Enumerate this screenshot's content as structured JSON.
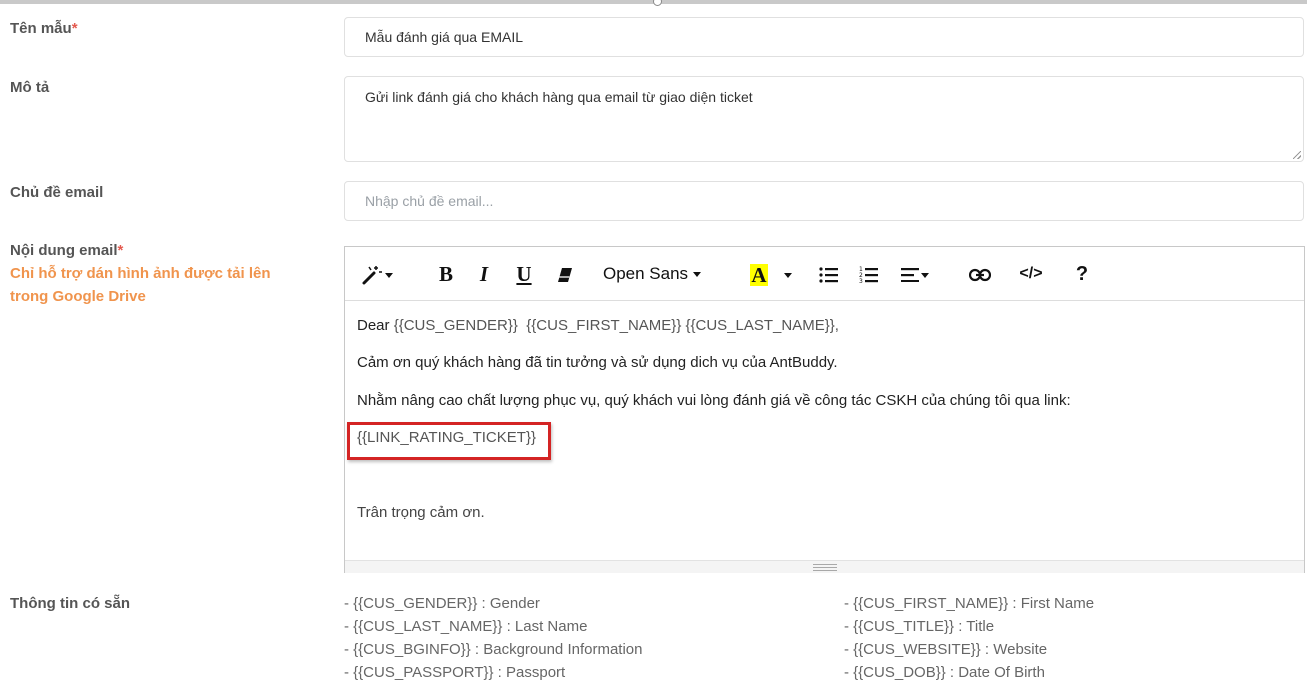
{
  "form": {
    "template_name": {
      "label": "Tên mẫu",
      "required_mark": "*",
      "value": "Mẫu đánh giá qua EMAIL"
    },
    "description": {
      "label": "Mô tả",
      "value": "Gửi link đánh giá cho khách hàng qua email từ giao diện ticket"
    },
    "email_subject": {
      "label": "Chủ đề email",
      "value": "",
      "placeholder": "Nhập chủ đề email..."
    },
    "email_content": {
      "label": "Nội dung email",
      "required_mark": "*",
      "note": "Chỉ hỗ trợ dán hình ảnh được tải lên trong Google Drive"
    },
    "available_info": {
      "label": "Thông tin có sẵn"
    }
  },
  "editor": {
    "toolbar": {
      "font_name": "Open Sans",
      "bold_glyph": "B",
      "italic_glyph": "I",
      "underline_glyph": "U",
      "color_glyph": "A",
      "code_glyph": "</>",
      "help_glyph": "?",
      "color_highlight": "#ffff00",
      "icons": [
        "magic-wand-icon",
        "bold-icon",
        "italic-icon",
        "underline-icon",
        "eraser-icon",
        "text-color-icon",
        "bulleted-list-icon",
        "numbered-list-icon",
        "align-icon",
        "link-icon",
        "code-view-icon",
        "help-icon"
      ]
    },
    "content": {
      "line1_prefix": "Dear ",
      "line1_gender": "{{CUS_GENDER}}",
      "line1_first": "{{CUS_FIRST_NAME}}",
      "line1_last": "{{CUS_LAST_NAME}},",
      "line2": "Cảm ơn quý khách hàng đã tin tưởng và sử dụng dich vụ của AntBuddy.",
      "line3": "Nhằm nâng cao chất lượng phục vụ, quý khách vui lòng đánh giá về công tác CSKH của chúng tôi qua link:",
      "link_var": "{{LINK_RATING_TICKET}}",
      "closing": "Trân trọng cảm ơn."
    },
    "highlight_color": "#d42424"
  },
  "available_vars": {
    "left": [
      "- {{CUS_GENDER}} : Gender",
      "- {{CUS_LAST_NAME}} : Last Name",
      "- {{CUS_BGINFO}} : Background Information",
      "- {{CUS_PASSPORT}} : Passport"
    ],
    "right": [
      "- {{CUS_FIRST_NAME}} : First Name",
      "- {{CUS_TITLE}} : Title",
      "- {{CUS_WEBSITE}} : Website",
      "- {{CUS_DOB}} : Date Of Birth"
    ]
  },
  "colors": {
    "required": "#e45a4f",
    "note": "#f0944d"
  }
}
